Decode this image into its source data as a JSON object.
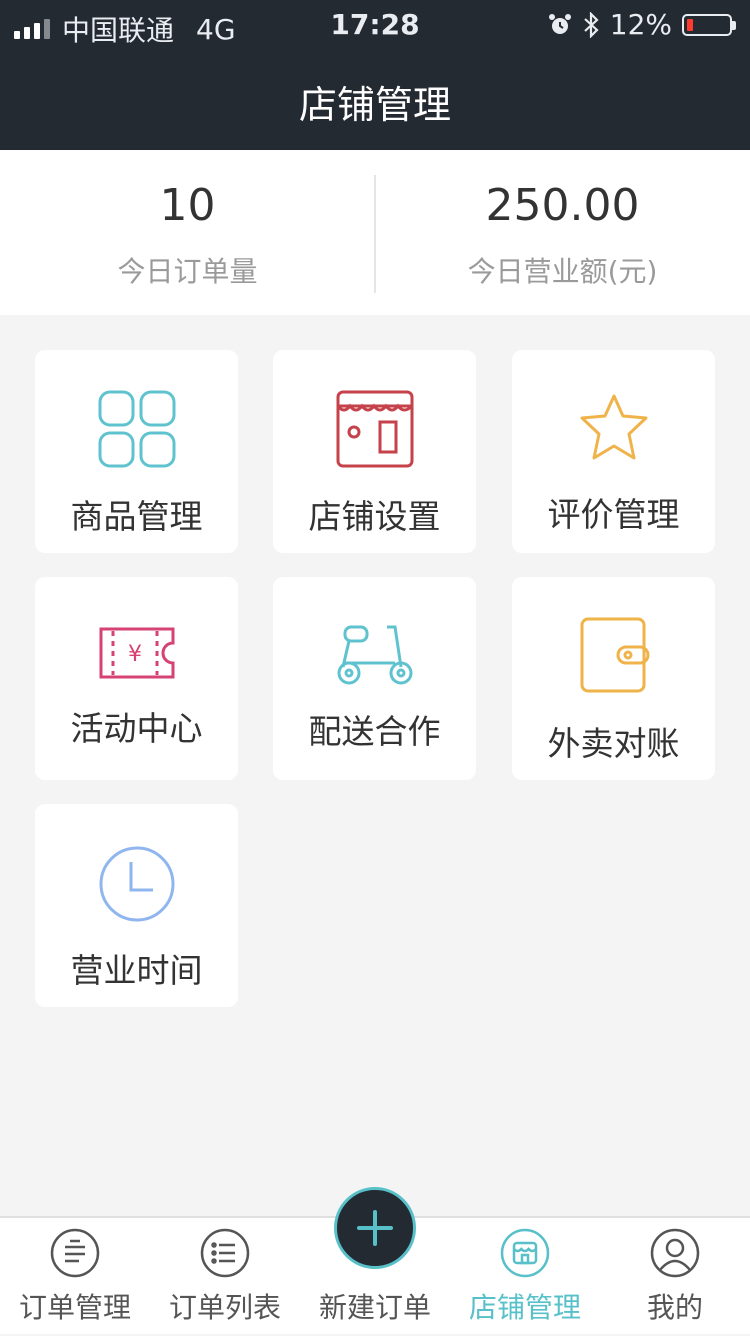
{
  "status_bar": {
    "carrier": "中国联通",
    "network": "4G",
    "time": "17:28",
    "battery": "12%"
  },
  "navbar": {
    "title": "店铺管理"
  },
  "stats": [
    {
      "value": "10",
      "label": "今日订单量"
    },
    {
      "value": "250.00",
      "label": "今日营业额(元)"
    }
  ],
  "grid": [
    {
      "label": "商品管理",
      "icon": "grid-squares-icon",
      "color": "#5fc3cf"
    },
    {
      "label": "店铺设置",
      "icon": "storefront-icon",
      "color": "#c6424b"
    },
    {
      "label": "评价管理",
      "icon": "star-icon",
      "color": "#efb34a"
    },
    {
      "label": "活动中心",
      "icon": "coupon-icon",
      "color": "#d64272"
    },
    {
      "label": "配送合作",
      "icon": "scooter-icon",
      "color": "#5fc3cf"
    },
    {
      "label": "外卖对账",
      "icon": "wallet-icon",
      "color": "#efb34a"
    },
    {
      "label": "营业时间",
      "icon": "clock-icon",
      "color": "#8fb6ee"
    }
  ],
  "tabs": [
    {
      "label": "订单管理",
      "icon": "chat-bubble-icon",
      "active": false
    },
    {
      "label": "订单列表",
      "icon": "list-icon",
      "active": false
    },
    {
      "label": "新建订单",
      "icon": "plus-icon",
      "active": false
    },
    {
      "label": "店铺管理",
      "icon": "shop-icon",
      "active": true
    },
    {
      "label": "我的",
      "icon": "user-icon",
      "active": false
    }
  ],
  "colors": {
    "header_bg": "#242a32",
    "accent": "#58c0c8",
    "page_bg": "#f4f4f4"
  }
}
